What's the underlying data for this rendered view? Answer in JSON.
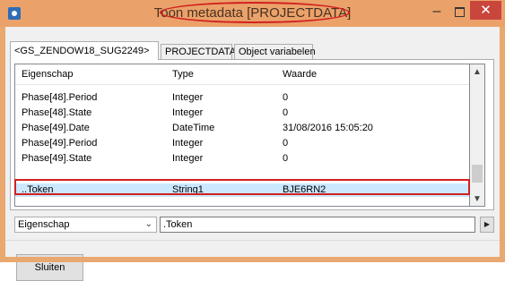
{
  "window": {
    "title": "Toon metadata [PROJECTDATA]",
    "minimize_icon": "minimize-icon",
    "maximize_icon": "maximize-icon",
    "close_icon": "close-icon",
    "accent_color": "#eaa26a",
    "highlight_color": "#d22020"
  },
  "tabs": [
    {
      "label": "<GS_ZENDOW18_SUG2249>",
      "active": true
    },
    {
      "label": "PROJECTDATA",
      "active": false
    },
    {
      "label": "Object variabelen",
      "active": false
    }
  ],
  "grid": {
    "columns": [
      "Eigenschap",
      "Type",
      "Waarde"
    ],
    "rows": [
      {
        "property": "Phase[48].Period",
        "type": "Integer",
        "value": "0"
      },
      {
        "property": "Phase[48].State",
        "type": "Integer",
        "value": "0"
      },
      {
        "property": "Phase[49].Date",
        "type": "DateTime",
        "value": "31/08/2016 15:05:20"
      },
      {
        "property": "Phase[49].Period",
        "type": "Integer",
        "value": "0"
      },
      {
        "property": "Phase[49].State",
        "type": "Integer",
        "value": "0"
      },
      {
        "property": "..Token",
        "type": "String1",
        "value": "BJE6RN2",
        "selected": true
      }
    ]
  },
  "filter": {
    "property_selected": "Eigenschap",
    "value": ".Token",
    "go_icon": "play-right-icon"
  },
  "buttons": {
    "close_label": "Sluiten"
  }
}
